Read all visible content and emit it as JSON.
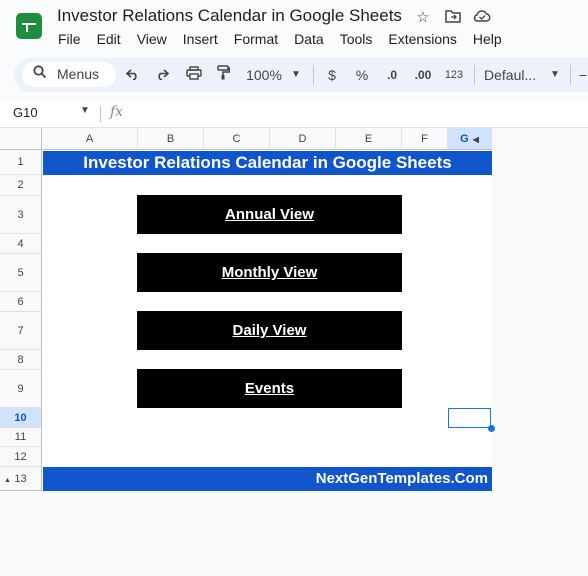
{
  "app": {
    "title": "Investor Relations Calendar in Google Sheets",
    "icons": [
      "star-icon",
      "move-to-folder-icon",
      "cloud-status-icon"
    ]
  },
  "menubar": [
    "File",
    "Edit",
    "View",
    "Insert",
    "Format",
    "Data",
    "Tools",
    "Extensions",
    "Help"
  ],
  "toolbar": {
    "search_label": "Menus",
    "zoom": "100%",
    "currency": "$",
    "percent": "%",
    "decrease_decimal": ".0",
    "increase_decimal": ".00",
    "number_format": "123",
    "font": "Defaul...",
    "minus": "−"
  },
  "formula_bar": {
    "name_box": "G10",
    "fx": "fx",
    "value": ""
  },
  "columns": [
    "A",
    "B",
    "C",
    "D",
    "E",
    "F",
    "G"
  ],
  "selected_column": "G",
  "rows": [
    "1",
    "2",
    "3",
    "4",
    "5",
    "6",
    "7",
    "8",
    "9",
    "10",
    "11",
    "12",
    "13"
  ],
  "selected_row": "10",
  "sheet": {
    "title_banner": "Investor Relations Calendar in Google Sheets",
    "buttons": [
      "Annual View",
      "Monthly View",
      "Daily View",
      "Events"
    ],
    "footer": "NextGenTemplates.Com"
  },
  "colors": {
    "banner_blue": "#1155cc",
    "button_black": "#000000",
    "selection_blue": "#1a73e8",
    "sheets_green": "#1e8e3e"
  }
}
